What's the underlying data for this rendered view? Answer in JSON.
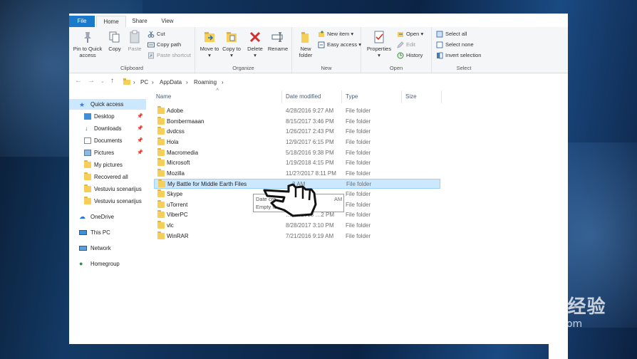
{
  "ribbon_tabs": {
    "file": "File",
    "home": "Home",
    "share": "Share",
    "view": "View"
  },
  "clipboard": {
    "pin": "Pin to Quick access",
    "copy": "Copy",
    "paste": "Paste",
    "cut": "Cut",
    "copy_path": "Copy path",
    "paste_shortcut": "Paste shortcut",
    "label": "Clipboard"
  },
  "organize": {
    "move": "Move to",
    "copy": "Copy to",
    "delete": "Delete",
    "rename": "Rename",
    "label": "Organize"
  },
  "new": {
    "folder": "New folder",
    "item": "New item",
    "easy": "Easy access",
    "label": "New"
  },
  "open": {
    "properties": "Properties",
    "open": "Open",
    "edit": "Edit",
    "history": "History",
    "label": "Open"
  },
  "select": {
    "all": "Select all",
    "none": "Select none",
    "invert": "Invert selection",
    "label": "Select"
  },
  "address": {
    "pc": "PC",
    "appdata": "AppData",
    "roaming": "Roaming"
  },
  "nav": [
    {
      "label": "Quick access"
    },
    {
      "label": "Desktop",
      "pin": "📌"
    },
    {
      "label": "Downloads",
      "pin": "📌"
    },
    {
      "label": "Documents",
      "pin": "📌"
    },
    {
      "label": "Pictures",
      "pin": "📌"
    },
    {
      "label": "My pictures"
    },
    {
      "label": "Recovered all"
    },
    {
      "label": "Vestuviu scenarijus"
    },
    {
      "label": "Vestuviu scenarijus"
    },
    {
      "label": "OneDrive"
    },
    {
      "label": "This PC"
    },
    {
      "label": "Network"
    },
    {
      "label": "Homegroup"
    }
  ],
  "columns": {
    "name": "Name",
    "date": "Date modified",
    "type": "Type",
    "size": "Size"
  },
  "files": [
    {
      "name": "Adobe",
      "date": "4/28/2016 9:27 AM",
      "type": "File folder"
    },
    {
      "name": "Bombermaaan",
      "date": "8/15/2017 3:46 PM",
      "type": "File folder"
    },
    {
      "name": "dvdcss",
      "date": "1/26/2017 2:43 PM",
      "type": "File folder"
    },
    {
      "name": "Hola",
      "date": "12/9/2017 6:15 PM",
      "type": "File folder"
    },
    {
      "name": "Macromedia",
      "date": "5/18/2016 9:38 PM",
      "type": "File folder"
    },
    {
      "name": "Microsoft",
      "date": "1/19/2018 4:15 PM",
      "type": "File folder"
    },
    {
      "name": "Mozilla",
      "date": "11/2?/2017 8:11 PM",
      "type": "File folder"
    },
    {
      "name": "My Battle for Middle Earth Files",
      "date": "…3 AM",
      "type": "File folder"
    },
    {
      "name": "Skype",
      "date": "",
      "type": "File folder"
    },
    {
      "name": "uTorrent",
      "date": "",
      "type": "File folder"
    },
    {
      "name": "ViberPC",
      "date": "…/17/2018 …2 PM",
      "type": "File folder"
    },
    {
      "name": "vlc",
      "date": "8/28/2017 3:10 PM",
      "type": "File folder"
    },
    {
      "name": "WinRAR",
      "date": "7/21/2016 9:19 AM",
      "type": "File folder"
    }
  ],
  "tooltip": {
    "line1": "Date cre…",
    "line2": "Empty fol…",
    "suffix": "AM"
  },
  "watermark": {
    "brand": "Bai du 经验",
    "url": "jingyan.baidu.com"
  }
}
